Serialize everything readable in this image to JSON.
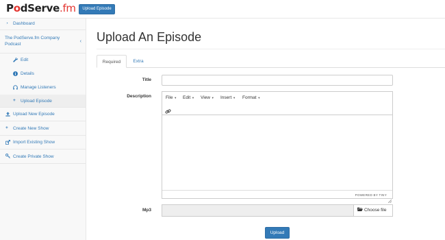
{
  "header": {
    "logo_main_1": "P",
    "logo_o": "o",
    "logo_main_2": "dServe",
    "logo_fm": ".fm",
    "upload_button": "Upload Episode"
  },
  "sidebar": {
    "dashboard": {
      "label": "Dashboard",
      "icon": "dashboard-icon"
    },
    "company": {
      "label": "The PodServe.fm Company Podcast",
      "chevron": "chevron-left-icon"
    },
    "edit": {
      "label": "Edit",
      "icon": "wrench-icon"
    },
    "details": {
      "label": "Details",
      "icon": "info-icon"
    },
    "manage_listeners": {
      "label": "Manage Listeners",
      "icon": "headphones-icon"
    },
    "upload_episode": {
      "label": "Upload Episode",
      "icon": "plus-icon"
    },
    "upload_new_episode": {
      "label": "Upload New Episode",
      "icon": "upload-icon"
    },
    "create_new_show": {
      "label": "Create New Show",
      "icon": "plus-icon"
    },
    "import_existing_show": {
      "label": "Import Existing Show",
      "icon": "import-icon"
    },
    "create_private_show": {
      "label": "Create Private Show",
      "icon": "key-icon"
    }
  },
  "main": {
    "page_title": "Upload An Episode",
    "tabs": [
      {
        "label": "Required",
        "active": true
      },
      {
        "label": "Extra",
        "active": false
      }
    ],
    "form": {
      "title_label": "Title",
      "title_value": "",
      "description_label": "Description",
      "editor_menus": [
        "File",
        "Edit",
        "View",
        "Insert",
        "Format"
      ],
      "powered_by": "POWERED BY TINY",
      "mp3_label": "Mp3",
      "choose_file": "Choose file",
      "submit": "Upload"
    }
  },
  "colors": {
    "primary": "#337ab7",
    "brand_accent": "#e3342f",
    "sidebar_bg": "#f8f8f8"
  }
}
